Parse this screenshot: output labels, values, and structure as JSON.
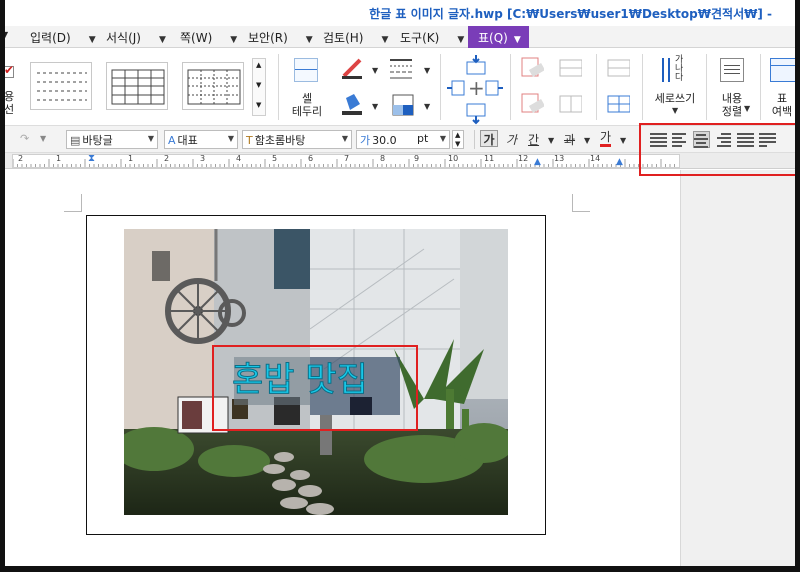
{
  "window": {
    "title": "한글 표 이미지 글자.hwp [C:₩Users₩user1₩Desktop₩견적서₩] -"
  },
  "menu": [
    {
      "label": "입력(D)"
    },
    {
      "label": "서식(J)"
    },
    {
      "label": "쪽(W)"
    },
    {
      "label": "보안(R)"
    },
    {
      "label": "검토(H)"
    },
    {
      "label": "도구(K)"
    },
    {
      "label": "표(Q)",
      "active": true
    }
  ],
  "ribbon": {
    "left_partial_label": "용\n선",
    "cell_border_label": "셀\n테두리",
    "vertical_text_label": "세로쓰기",
    "vertical_text_glyph": "가\n나\n다",
    "content_align_label": "내용\n정렬",
    "table_margin_label": "표\n여백"
  },
  "format_bar": {
    "style": "바탕글",
    "font_lang": "대표",
    "font": "함초롬바탕",
    "size": "30.0",
    "unit": "pt",
    "bold": "가",
    "italic": "가",
    "underline": "간",
    "strike": "과",
    "color": "가"
  },
  "ruler": {
    "marks": [
      "2",
      "1",
      "1",
      "2",
      "3",
      "4",
      "5",
      "6",
      "7",
      "8",
      "9",
      "10",
      "11",
      "12",
      "13",
      "14"
    ]
  },
  "document": {
    "image_text": "혼밥 맛집",
    "colors": {
      "accent": "#7a3db8",
      "title": "#1e5fbf",
      "highlight": "#e02020",
      "image_text": "#18c8e8"
    }
  }
}
